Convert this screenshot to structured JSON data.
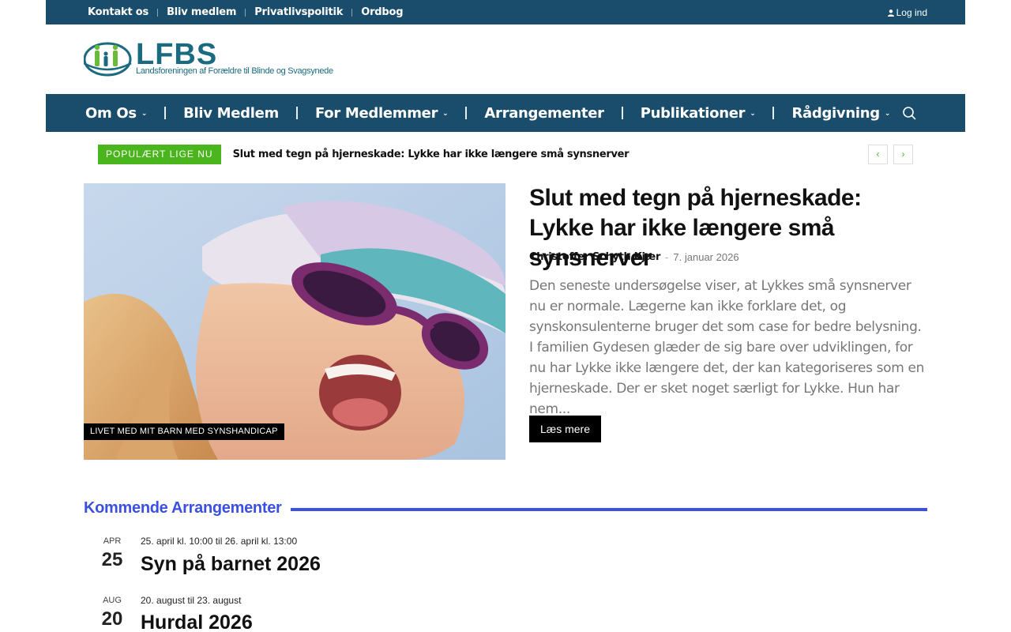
{
  "topbar": {
    "links": [
      "Kontakt os",
      "Bliv medlem",
      "Privatlivspolitik",
      "Ordbog"
    ],
    "login": "Log ind"
  },
  "logo": {
    "name": "LFBS",
    "tagline": "Landsforeningen af Forældre til Blinde og Svagsynede"
  },
  "nav": {
    "items": [
      {
        "label": "Om Os",
        "has_dropdown": true
      },
      {
        "label": "Bliv Medlem",
        "has_dropdown": false
      },
      {
        "label": "For Medlemmer",
        "has_dropdown": true
      },
      {
        "label": "Arrangementer",
        "has_dropdown": false
      },
      {
        "label": "Publikationer",
        "has_dropdown": true
      },
      {
        "label": "Rådgivning",
        "has_dropdown": true
      }
    ]
  },
  "trending": {
    "tag": "POPULÆRT LIGE NU",
    "headline": "Slut med tegn på hjerneskade: Lykke har ikke længere små synsnerver",
    "prev": "‹",
    "next": "›"
  },
  "hero": {
    "category": "LIVET MED MIT BARN MED SYNSHANDICAP",
    "title": "Slut med tegn på hjerneskade: Lykke har ikke længere små synsnerver",
    "author": "Christoffer Schyth Kjær",
    "date": "7. januar 2026",
    "excerpt": "Den seneste undersøgelse viser, at Lykkes små synsnerver nu er normale. Lægerne kan ikke forklare det, og synskonsulenterne bruger det som case for bedre belysning. I familien Gydesen glæder de sig bare over udviklingen, for nu har Lykke ikke længere det, der kan kategoriseres som en hjerneskade. Der er sket noget særligt for Lykke. Hun har nem...",
    "read_more": "Læs mere"
  },
  "events": {
    "heading": "Kommende Arrangementer",
    "items": [
      {
        "month": "APR",
        "day": "25",
        "when": "25. april kl. 10:00 til 26. april kl. 13:00",
        "name": "Syn på barnet 2026"
      },
      {
        "month": "AUG",
        "day": "20",
        "when": "20. august til 23. august",
        "name": "Hurdal 2026"
      }
    ]
  },
  "colors": {
    "navy": "#1a4d6b",
    "green": "#4bb51d",
    "blue": "#3c50e0",
    "logo": "#1a6a80"
  }
}
